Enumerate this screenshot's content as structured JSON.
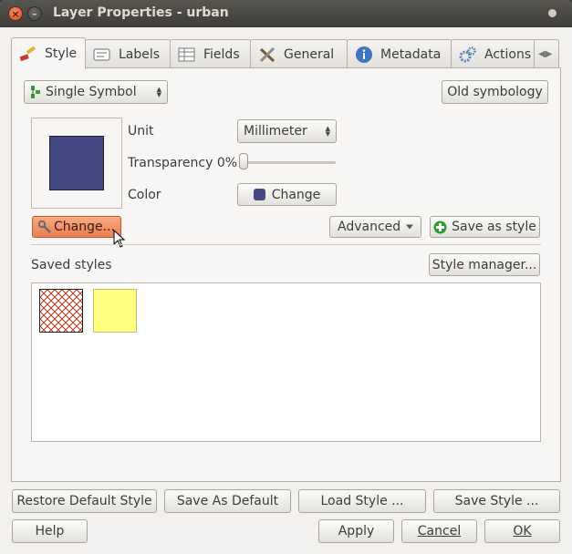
{
  "window": {
    "title": "Layer Properties - urban"
  },
  "tabs": [
    {
      "label": "Style",
      "icon": "brush-icon"
    },
    {
      "label": "Labels",
      "icon": "labels-icon"
    },
    {
      "label": "Fields",
      "icon": "table-icon"
    },
    {
      "label": "General",
      "icon": "tools-icon"
    },
    {
      "label": "Metadata",
      "icon": "info-icon"
    },
    {
      "label": "Actions",
      "icon": "gears-icon"
    }
  ],
  "style": {
    "renderer_select": "Single Symbol",
    "old_symbology": "Old symbology",
    "symbol_color": "#454a84",
    "unit_label": "Unit",
    "unit_value": "Millimeter",
    "transparency_label": "Transparency 0%",
    "transparency_value": 0,
    "color_label": "Color",
    "color_change": "Change",
    "change_symbol": "Change...",
    "advanced": "Advanced",
    "save_as_style": "Save as style",
    "saved_styles_label": "Saved styles",
    "style_manager": "Style manager..."
  },
  "swatches": [
    {
      "name": "red-hatched-swatch",
      "color": "#b5361f"
    },
    {
      "name": "yellow-swatch",
      "color": "#ffff80"
    }
  ],
  "footer": {
    "restore_default": "Restore Default Style",
    "save_as_default": "Save As Default",
    "load_style": "Load Style ...",
    "save_style": "Save Style ...",
    "help": "Help",
    "apply": "Apply",
    "cancel": "Cancel",
    "ok": "OK"
  }
}
